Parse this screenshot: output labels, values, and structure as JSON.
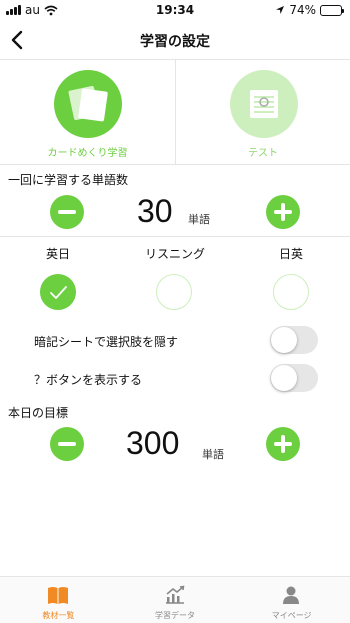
{
  "status_bar": {
    "carrier": "au",
    "time": "19:34",
    "battery": "74%",
    "battery_level": 0.74
  },
  "nav": {
    "title": "学習の設定"
  },
  "modes": [
    {
      "label": "カードめくり学習",
      "active": true
    },
    {
      "label": "テスト",
      "active": false
    }
  ],
  "word_count": {
    "title": "一回に学習する単語数",
    "value": "30",
    "unit": "単語"
  },
  "languages": [
    {
      "label": "英日",
      "checked": true
    },
    {
      "label": "リスニング",
      "checked": false
    },
    {
      "label": "日英",
      "checked": false
    }
  ],
  "toggles": [
    {
      "label": "暗記シートで選択肢を隠す",
      "on": false
    },
    {
      "label": "？ボタンを表示する",
      "on": false
    }
  ],
  "daily_goal": {
    "title": "本日の目標",
    "value": "300",
    "unit": "単語"
  },
  "tabs": [
    {
      "label": "教材一覧",
      "active": true,
      "icon": "book-icon"
    },
    {
      "label": "学習データ",
      "active": false,
      "icon": "chart-icon"
    },
    {
      "label": "マイページ",
      "active": false,
      "icon": "person-icon"
    }
  ],
  "colors": {
    "accent": "#6ccf3f",
    "accent_light": "#cdefbd",
    "tab_active": "#f08a24"
  }
}
